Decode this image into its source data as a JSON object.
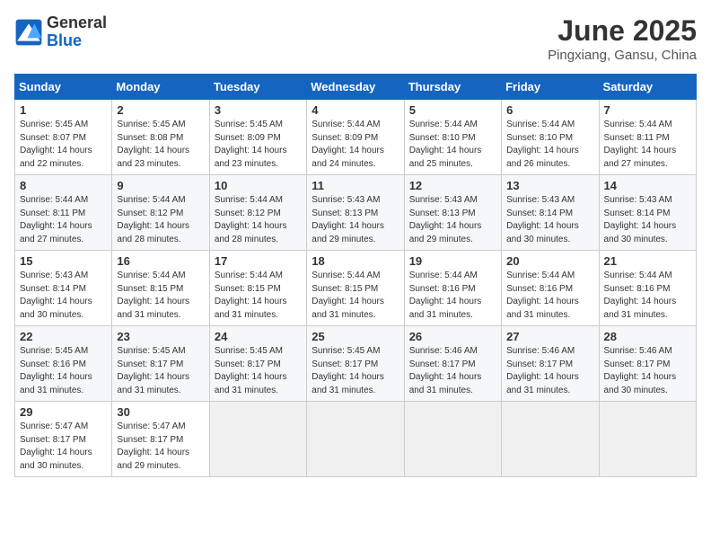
{
  "logo": {
    "general": "General",
    "blue": "Blue"
  },
  "title": "June 2025",
  "location": "Pingxiang, Gansu, China",
  "days_of_week": [
    "Sunday",
    "Monday",
    "Tuesday",
    "Wednesday",
    "Thursday",
    "Friday",
    "Saturday"
  ],
  "weeks": [
    [
      {
        "day": "1",
        "info": "Sunrise: 5:45 AM\nSunset: 8:07 PM\nDaylight: 14 hours\nand 22 minutes."
      },
      {
        "day": "2",
        "info": "Sunrise: 5:45 AM\nSunset: 8:08 PM\nDaylight: 14 hours\nand 23 minutes."
      },
      {
        "day": "3",
        "info": "Sunrise: 5:45 AM\nSunset: 8:09 PM\nDaylight: 14 hours\nand 23 minutes."
      },
      {
        "day": "4",
        "info": "Sunrise: 5:44 AM\nSunset: 8:09 PM\nDaylight: 14 hours\nand 24 minutes."
      },
      {
        "day": "5",
        "info": "Sunrise: 5:44 AM\nSunset: 8:10 PM\nDaylight: 14 hours\nand 25 minutes."
      },
      {
        "day": "6",
        "info": "Sunrise: 5:44 AM\nSunset: 8:10 PM\nDaylight: 14 hours\nand 26 minutes."
      },
      {
        "day": "7",
        "info": "Sunrise: 5:44 AM\nSunset: 8:11 PM\nDaylight: 14 hours\nand 27 minutes."
      }
    ],
    [
      {
        "day": "8",
        "info": "Sunrise: 5:44 AM\nSunset: 8:11 PM\nDaylight: 14 hours\nand 27 minutes."
      },
      {
        "day": "9",
        "info": "Sunrise: 5:44 AM\nSunset: 8:12 PM\nDaylight: 14 hours\nand 28 minutes."
      },
      {
        "day": "10",
        "info": "Sunrise: 5:44 AM\nSunset: 8:12 PM\nDaylight: 14 hours\nand 28 minutes."
      },
      {
        "day": "11",
        "info": "Sunrise: 5:43 AM\nSunset: 8:13 PM\nDaylight: 14 hours\nand 29 minutes."
      },
      {
        "day": "12",
        "info": "Sunrise: 5:43 AM\nSunset: 8:13 PM\nDaylight: 14 hours\nand 29 minutes."
      },
      {
        "day": "13",
        "info": "Sunrise: 5:43 AM\nSunset: 8:14 PM\nDaylight: 14 hours\nand 30 minutes."
      },
      {
        "day": "14",
        "info": "Sunrise: 5:43 AM\nSunset: 8:14 PM\nDaylight: 14 hours\nand 30 minutes."
      }
    ],
    [
      {
        "day": "15",
        "info": "Sunrise: 5:43 AM\nSunset: 8:14 PM\nDaylight: 14 hours\nand 30 minutes."
      },
      {
        "day": "16",
        "info": "Sunrise: 5:44 AM\nSunset: 8:15 PM\nDaylight: 14 hours\nand 31 minutes."
      },
      {
        "day": "17",
        "info": "Sunrise: 5:44 AM\nSunset: 8:15 PM\nDaylight: 14 hours\nand 31 minutes."
      },
      {
        "day": "18",
        "info": "Sunrise: 5:44 AM\nSunset: 8:15 PM\nDaylight: 14 hours\nand 31 minutes."
      },
      {
        "day": "19",
        "info": "Sunrise: 5:44 AM\nSunset: 8:16 PM\nDaylight: 14 hours\nand 31 minutes."
      },
      {
        "day": "20",
        "info": "Sunrise: 5:44 AM\nSunset: 8:16 PM\nDaylight: 14 hours\nand 31 minutes."
      },
      {
        "day": "21",
        "info": "Sunrise: 5:44 AM\nSunset: 8:16 PM\nDaylight: 14 hours\nand 31 minutes."
      }
    ],
    [
      {
        "day": "22",
        "info": "Sunrise: 5:45 AM\nSunset: 8:16 PM\nDaylight: 14 hours\nand 31 minutes."
      },
      {
        "day": "23",
        "info": "Sunrise: 5:45 AM\nSunset: 8:17 PM\nDaylight: 14 hours\nand 31 minutes."
      },
      {
        "day": "24",
        "info": "Sunrise: 5:45 AM\nSunset: 8:17 PM\nDaylight: 14 hours\nand 31 minutes."
      },
      {
        "day": "25",
        "info": "Sunrise: 5:45 AM\nSunset: 8:17 PM\nDaylight: 14 hours\nand 31 minutes."
      },
      {
        "day": "26",
        "info": "Sunrise: 5:46 AM\nSunset: 8:17 PM\nDaylight: 14 hours\nand 31 minutes."
      },
      {
        "day": "27",
        "info": "Sunrise: 5:46 AM\nSunset: 8:17 PM\nDaylight: 14 hours\nand 31 minutes."
      },
      {
        "day": "28",
        "info": "Sunrise: 5:46 AM\nSunset: 8:17 PM\nDaylight: 14 hours\nand 30 minutes."
      }
    ],
    [
      {
        "day": "29",
        "info": "Sunrise: 5:47 AM\nSunset: 8:17 PM\nDaylight: 14 hours\nand 30 minutes."
      },
      {
        "day": "30",
        "info": "Sunrise: 5:47 AM\nSunset: 8:17 PM\nDaylight: 14 hours\nand 29 minutes."
      },
      {
        "day": "",
        "info": ""
      },
      {
        "day": "",
        "info": ""
      },
      {
        "day": "",
        "info": ""
      },
      {
        "day": "",
        "info": ""
      },
      {
        "day": "",
        "info": ""
      }
    ]
  ]
}
